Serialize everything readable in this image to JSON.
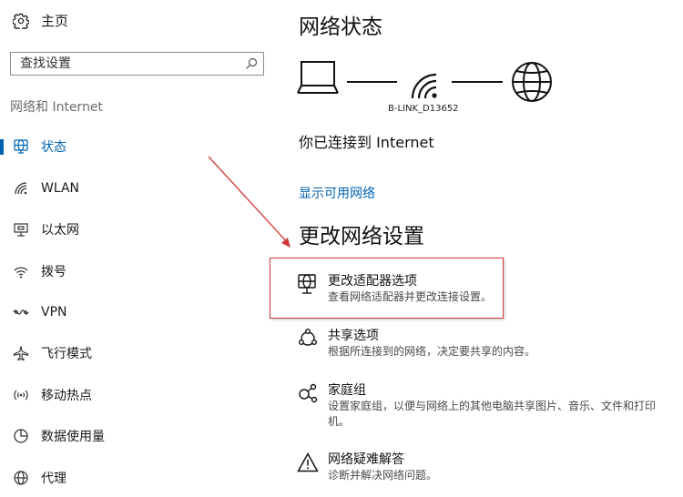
{
  "sidebar": {
    "home_label": "主页",
    "search_placeholder": "查找设置",
    "section_title": "网络和 Internet",
    "items": [
      {
        "label": "状态",
        "icon": "globe-icon",
        "active": true
      },
      {
        "label": "WLAN",
        "icon": "wifi-icon"
      },
      {
        "label": "以太网",
        "icon": "ethernet-icon"
      },
      {
        "label": "拨号",
        "icon": "dialup-icon"
      },
      {
        "label": "VPN",
        "icon": "vpn-icon"
      },
      {
        "label": "飞行模式",
        "icon": "airplane-icon"
      },
      {
        "label": "移动热点",
        "icon": "hotspot-icon"
      },
      {
        "label": "数据使用量",
        "icon": "data-usage-icon"
      },
      {
        "label": "代理",
        "icon": "globe-icon"
      }
    ]
  },
  "main": {
    "status_title": "网络状态",
    "network_name": "B-LINK_D13652",
    "connected_text": "你已连接到 Internet",
    "show_networks_link": "显示可用网络",
    "change_title": "更改网络设置",
    "options": [
      {
        "title": "更改适配器选项",
        "desc": "查看网络适配器并更改连接设置。",
        "icon": "adapter-globe-icon"
      },
      {
        "title": "共享选项",
        "desc": "根据所连接到的网络，决定要共享的内容。",
        "icon": "share-icon"
      },
      {
        "title": "家庭组",
        "desc": "设置家庭组，以便与网络上的其他电脑共享图片、音乐、文件和打印机。",
        "icon": "homegroup-icon"
      },
      {
        "title": "网络疑难解答",
        "desc": "诊断并解决网络问题。",
        "icon": "warning-icon"
      }
    ]
  },
  "colors": {
    "accent": "#0063b1",
    "annotation": "#d23a3a"
  }
}
